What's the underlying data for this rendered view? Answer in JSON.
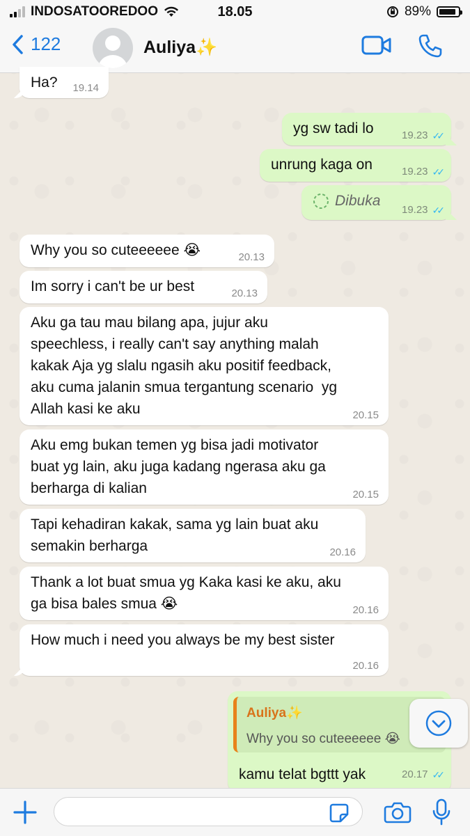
{
  "status_bar": {
    "carrier": "INDOSATOOREDOO",
    "time": "18.05",
    "battery": "89%",
    "battery_level": 0.89
  },
  "header": {
    "back_count": "122",
    "contact_name": "Auliya✨",
    "video_icon": "video-camera-icon",
    "call_icon": "phone-icon"
  },
  "messages": [
    {
      "text": "Ha?",
      "time": "19.14",
      "dir": "in"
    },
    {
      "text": "yg sw tadi lo",
      "time": "19.23",
      "dir": "out",
      "read": true
    },
    {
      "text": "unrung kaga on",
      "time": "19.23",
      "dir": "out",
      "read": true
    },
    {
      "text": "Dibuka",
      "time": "19.23",
      "dir": "out",
      "read": true,
      "view_once": true
    },
    {
      "text": "Why you so cuteeeeee 😭",
      "time": "20.13",
      "dir": "in"
    },
    {
      "text": "Im sorry i can't be ur best",
      "time": "20.13",
      "dir": "in"
    },
    {
      "text": "Aku ga tau mau bilang apa, jujur aku\nspeechless, i really can't say anything malah\nkakak Aja yg slalu ngasih aku positif feedback,\naku cuma jalanin smua tergantung scenario  yg\nAllah kasi ke aku",
      "time": "20.15",
      "dir": "in"
    },
    {
      "text": "Aku emg bukan temen yg bisa jadi motivator\nbuat yg lain, aku juga kadang ngerasa aku ga\nberharga di kalian",
      "time": "20.15",
      "dir": "in"
    },
    {
      "text": "Tapi kehadiran kakak, sama yg lain buat aku\nsemakin berharga",
      "time": "20.16",
      "dir": "in"
    },
    {
      "text": "Thank a lot buat smua yg Kaka kasi ke aku, aku\nga bisa bales smua 😭",
      "time": "20.16",
      "dir": "in"
    },
    {
      "text": "How much i need you always be my best sister",
      "time": "20.16",
      "dir": "in"
    },
    {
      "text": "kamu telat bgttt yak",
      "time": "20.17",
      "dir": "out",
      "read": true,
      "reply_to": {
        "name": "Auliya✨",
        "text": "Why you so cuteeeeee 😭"
      }
    }
  ],
  "colors": {
    "accent": "#1E7BDF",
    "outgoing_bubble": "#DCF8C6",
    "incoming_bubble": "#FFFFFF",
    "read_ticks": "#34B7F1",
    "reply_name": "#D9731A"
  },
  "input_bar": {
    "placeholder": "",
    "icons": [
      "plus-icon",
      "sticker-icon",
      "camera-icon",
      "microphone-icon"
    ]
  }
}
